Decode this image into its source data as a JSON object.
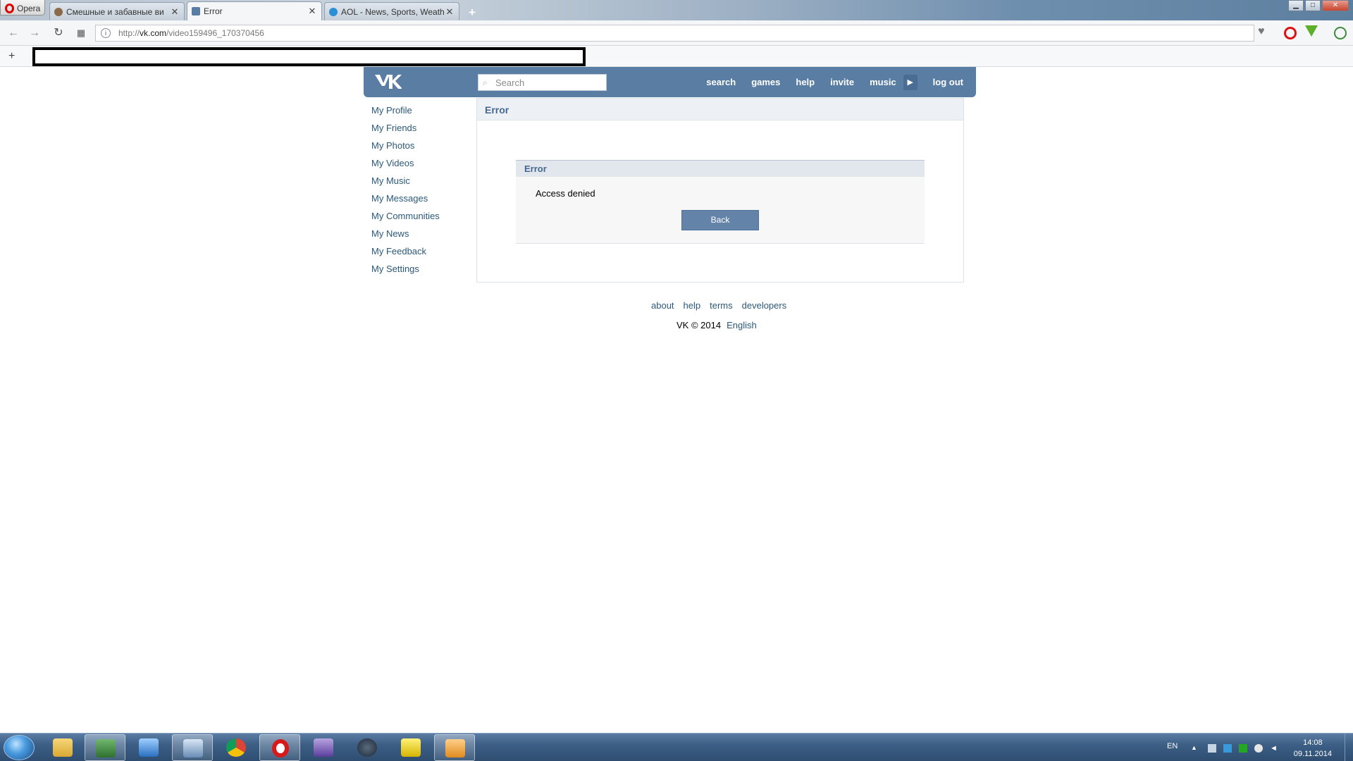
{
  "browser": {
    "menu_label": "Opera",
    "tabs": [
      {
        "title": "Смешные и забавные ви",
        "active": false
      },
      {
        "title": "Error",
        "active": true
      },
      {
        "title": "AOL - News, Sports, Weath",
        "active": false
      }
    ],
    "new_tab_label": "+",
    "url_prefix": "http://",
    "url_host": "vk.com",
    "url_path": "/video159496_170370456",
    "bookmarks_add_label": "+"
  },
  "vk": {
    "search_placeholder": "Search",
    "nav": {
      "search": "search",
      "games": "games",
      "help": "help",
      "invite": "invite",
      "music": "music",
      "logout": "log out"
    },
    "left_menu": [
      "My Profile",
      "My Friends",
      "My Photos",
      "My Videos",
      "My Music",
      "My Messages",
      "My Communities",
      "My News",
      "My Feedback",
      "My Settings"
    ],
    "page_title": "Error",
    "error_box": {
      "title": "Error",
      "message": "Access denied",
      "button": "Back"
    },
    "footer": {
      "links": [
        "about",
        "help",
        "terms",
        "developers"
      ],
      "copyright": "VK © 2014",
      "language": "English"
    },
    "colors": {
      "brand": "#597da3",
      "link": "#2b587a",
      "button": "#6383a8"
    }
  },
  "taskbar": {
    "apps": [
      "file-explorer",
      "app-green-monitor",
      "app-blue-window",
      "app-network-tool",
      "chrome",
      "opera",
      "visual-studio",
      "steam",
      "app-yellow-robot",
      "media-player"
    ],
    "language": "EN",
    "time": "14:08",
    "date": "09.11.2014"
  }
}
